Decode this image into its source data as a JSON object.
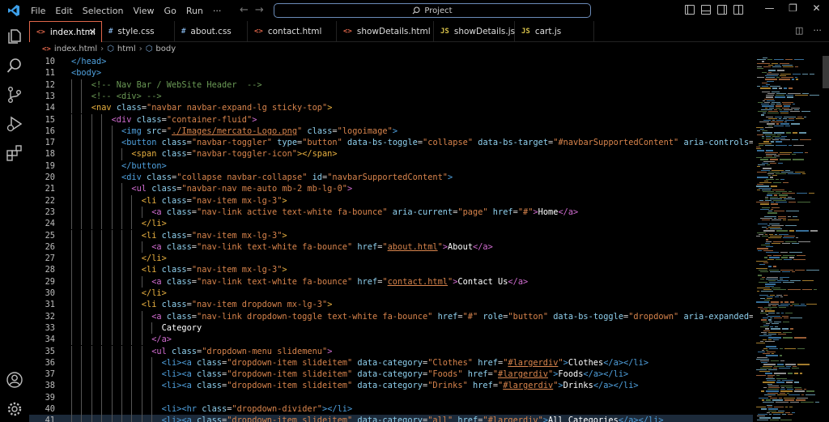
{
  "menu": [
    "File",
    "Edit",
    "Selection",
    "View",
    "Go",
    "Run",
    "···"
  ],
  "search": {
    "label": "Project"
  },
  "tabs": [
    {
      "label": "index.html",
      "icon": "<>",
      "icon_color": "#e0664a",
      "active": true
    },
    {
      "label": "style.css",
      "icon": "#",
      "icon_color": "#7aa7d6",
      "active": false
    },
    {
      "label": "about.css",
      "icon": "#",
      "icon_color": "#7aa7d6",
      "active": false
    },
    {
      "label": "contact.html",
      "icon": "<>",
      "icon_color": "#e0664a",
      "active": false
    },
    {
      "label": "showDetails.html",
      "icon": "<>",
      "icon_color": "#e0664a",
      "active": false
    },
    {
      "label": "showDetails.js",
      "icon": "JS",
      "icon_color": "#d8c24a",
      "active": false
    },
    {
      "label": "cart.js",
      "icon": "JS",
      "icon_color": "#d8c24a",
      "active": false
    }
  ],
  "breadcrumb": [
    "index.html",
    "html",
    "body"
  ],
  "code_lines": [
    {
      "n": "10",
      "indent": 0,
      "html": "<span class='t'>&lt;/head&gt;</span>"
    },
    {
      "n": "11",
      "indent": 0,
      "html": "<span class='t'>&lt;body&gt;</span>"
    },
    {
      "n": "12",
      "indent": 2,
      "html": "<span class='cm'>&lt;!-- Nav Bar / WebSite Header  --&gt;</span>"
    },
    {
      "n": "13",
      "indent": 2,
      "html": "<span class='cm'>&lt;!-- &lt;div&gt; --&gt;</span>"
    },
    {
      "n": "14",
      "indent": 2,
      "html": "<span class='tg'>&lt;nav</span> <span class='at'>class</span><span class='br'>=</span><span class='st'>\"navbar navbar-expand-lg sticky-top\"</span><span class='tg'>&gt;</span>"
    },
    {
      "n": "15",
      "indent": 4,
      "html": "<span class='t' style='color:#d06cd0'>&lt;div</span> <span class='at'>class</span><span class='br'>=</span><span class='st'>\"container-fluid\"</span><span class='t' style='color:#d06cd0'>&gt;</span>"
    },
    {
      "n": "16",
      "indent": 5,
      "html": "<span class='t'>&lt;img</span> <span class='at'>src</span><span class='br'>=</span><span class='st'>\"<u>./Images/mercato-Logo.png</u>\"</span> <span class='at'>class</span><span class='br'>=</span><span class='st'>\"logoimage\"</span><span class='t'>&gt;</span>"
    },
    {
      "n": "17",
      "indent": 5,
      "html": "<span class='t'>&lt;button</span> <span class='at'>class</span><span class='br'>=</span><span class='st'>\"navbar-toggler\"</span> <span class='at'>type</span><span class='br'>=</span><span class='st'>\"button\"</span> <span class='at'>data-bs-toggle</span><span class='br'>=</span><span class='st'>\"collapse\"</span> <span class='at'>data-bs-target</span><span class='br'>=</span><span class='st'>\"#navbarSupportedContent\"</span> <span class='at'>aria-controls</span><span class='br'>=</span><span class='st'>\"navbarSu</span>"
    },
    {
      "n": "18",
      "indent": 6,
      "html": "<span class='tg'>&lt;span</span> <span class='at'>class</span><span class='br'>=</span><span class='st'>\"navbar-toggler-icon\"</span><span class='tg'>&gt;&lt;/span&gt;</span>"
    },
    {
      "n": "19",
      "indent": 5,
      "html": "<span class='t'>&lt;/button&gt;</span>"
    },
    {
      "n": "20",
      "indent": 5,
      "html": "<span class='t'>&lt;div</span> <span class='at'>class</span><span class='br'>=</span><span class='st'>\"collapse navbar-collapse\"</span> <span class='at'>id</span><span class='br'>=</span><span class='st'>\"navbarSupportedContent\"</span><span class='t'>&gt;</span>"
    },
    {
      "n": "21",
      "indent": 6,
      "html": "<span class='tg' style='color:#d06cd0'>&lt;ul</span> <span class='at'>class</span><span class='br'>=</span><span class='st'>\"navbar-nav me-auto mb-2 mb-lg-0\"</span><span class='tg' style='color:#d06cd0'>&gt;</span>"
    },
    {
      "n": "22",
      "indent": 7,
      "html": "<span class='tg'>&lt;li</span> <span class='at'>class</span><span class='br'>=</span><span class='st'>\"nav-item mx-lg-3\"</span><span class='tg'>&gt;</span>"
    },
    {
      "n": "23",
      "indent": 8,
      "html": "<span class='tg' style='color:#d06cd0'>&lt;a</span> <span class='at'>class</span><span class='br'>=</span><span class='st'>\"nav-link active text-white fa-bounce\"</span> <span class='at'>aria-current</span><span class='br'>=</span><span class='st'>\"page\"</span> <span class='at'>href</span><span class='br'>=</span><span class='st'>\"#\"</span><span class='tg' style='color:#d06cd0'>&gt;</span><span class='tx'>Home</span><span class='tg' style='color:#d06cd0'>&lt;/a&gt;</span>"
    },
    {
      "n": "24",
      "indent": 7,
      "html": "<span class='tg'>&lt;/li&gt;</span>"
    },
    {
      "n": "25",
      "indent": 7,
      "html": "<span class='tg'>&lt;li</span> <span class='at'>class</span><span class='br'>=</span><span class='st'>\"nav-item mx-lg-3\"</span><span class='tg'>&gt;</span>"
    },
    {
      "n": "26",
      "indent": 8,
      "html": "<span class='tg' style='color:#d06cd0'>&lt;a</span> <span class='at'>class</span><span class='br'>=</span><span class='st'>\"nav-link text-white fa-bounce\"</span> <span class='at'>href</span><span class='br'>=</span><span class='st'>\"<u>about.html</u>\"</span><span class='tg' style='color:#d06cd0'>&gt;</span><span class='tx'>About</span><span class='tg' style='color:#d06cd0'>&lt;/a&gt;</span>"
    },
    {
      "n": "27",
      "indent": 7,
      "html": "<span class='tg'>&lt;/li&gt;</span>"
    },
    {
      "n": "28",
      "indent": 7,
      "html": "<span class='tg'>&lt;li</span> <span class='at'>class</span><span class='br'>=</span><span class='st'>\"nav-item mx-lg-3\"</span><span class='tg'>&gt;</span>"
    },
    {
      "n": "29",
      "indent": 8,
      "html": "<span class='tg' style='color:#d06cd0'>&lt;a</span> <span class='at'>class</span><span class='br'>=</span><span class='st'>\"nav-link text-white fa-bounce\"</span> <span class='at'>href</span><span class='br'>=</span><span class='st'>\"<u>contact.html</u>\"</span><span class='tg' style='color:#d06cd0'>&gt;</span><span class='tx'>Contact Us</span><span class='tg' style='color:#d06cd0'>&lt;/a&gt;</span>"
    },
    {
      "n": "30",
      "indent": 7,
      "html": "<span class='tg'>&lt;/li&gt;</span>"
    },
    {
      "n": "31",
      "indent": 7,
      "html": "<span class='tg'>&lt;li</span> <span class='at'>class</span><span class='br'>=</span><span class='st'>\"nav-item dropdown mx-lg-3\"</span><span class='tg'>&gt;</span>"
    },
    {
      "n": "32",
      "indent": 8,
      "html": "<span class='tg' style='color:#d06cd0'>&lt;a</span> <span class='at'>class</span><span class='br'>=</span><span class='st'>\"nav-link dropdown-toggle text-white fa-bounce\"</span> <span class='at'>href</span><span class='br'>=</span><span class='st'>\"#\"</span> <span class='at'>role</span><span class='br'>=</span><span class='st'>\"button\"</span> <span class='at'>data-bs-toggle</span><span class='br'>=</span><span class='st'>\"dropdown\"</span> <span class='at'>aria-expanded</span><span class='br'>=</span><span class='st'>\"false\"</span><span class='tg' style='color:#d06cd0'>&gt;</span>"
    },
    {
      "n": "33",
      "indent": 9,
      "html": "<span class='tx'>Category</span>"
    },
    {
      "n": "34",
      "indent": 8,
      "html": "<span class='tg' style='color:#d06cd0'>&lt;/a&gt;</span>"
    },
    {
      "n": "35",
      "indent": 8,
      "html": "<span class='tg' style='color:#d06cd0'>&lt;ul</span> <span class='at'>class</span><span class='br'>=</span><span class='st'>\"dropdown-menu slidemenu\"</span><span class='tg' style='color:#d06cd0'>&gt;</span>"
    },
    {
      "n": "36",
      "indent": 9,
      "html": "<span class='t'>&lt;li&gt;&lt;a</span> <span class='at'>class</span><span class='br'>=</span><span class='st'>\"dropdown-item slideitem\"</span> <span class='at'>data-category</span><span class='br'>=</span><span class='st'>\"Clothes\"</span> <span class='at'>href</span><span class='br'>=</span><span class='st'>\"<u>#largerdiv</u>\"</span><span class='t'>&gt;</span><span class='tx'>Clothes</span><span class='t'>&lt;/a&gt;&lt;/li&gt;</span>"
    },
    {
      "n": "37",
      "indent": 9,
      "html": "<span class='t'>&lt;li&gt;&lt;a</span> <span class='at'>class</span><span class='br'>=</span><span class='st'>\"dropdown-item slideitem\"</span> <span class='at'>data-category</span><span class='br'>=</span><span class='st'>\"Foods\"</span> <span class='at'>href</span><span class='br'>=</span><span class='st'>\"<u>#largerdiv</u>\"</span><span class='t'>&gt;</span><span class='tx'>Foods</span><span class='t'>&lt;/a&gt;&lt;/li&gt;</span>"
    },
    {
      "n": "38",
      "indent": 9,
      "html": "<span class='t'>&lt;li&gt;&lt;a</span> <span class='at'>class</span><span class='br'>=</span><span class='st'>\"dropdown-item slideitem\"</span> <span class='at'>data-category</span><span class='br'>=</span><span class='st'>\"Drinks\"</span> <span class='at'>href</span><span class='br'>=</span><span class='st'>\"<u>#largerdiv</u>\"</span><span class='t'>&gt;</span><span class='tx'>Drinks</span><span class='t'>&lt;/a&gt;&lt;/li&gt;</span>"
    },
    {
      "n": "39",
      "indent": 9,
      "html": ""
    },
    {
      "n": "40",
      "indent": 9,
      "html": "<span class='t'>&lt;li&gt;&lt;hr</span> <span class='at'>class</span><span class='br'>=</span><span class='st'>\"dropdown-divider\"</span><span class='t'>&gt;&lt;/li&gt;</span>"
    },
    {
      "n": "41",
      "indent": 9,
      "html": "<span class='t'>&lt;li&gt;&lt;a</span> <span class='at'>class</span><span class='br'>=</span><span class='st'>\"dropdown-item slideitem\"</span> <span class='at'>data-category</span><span class='br'>=</span><span class='st'>\"all\"</span> <span class='at'>href</span><span class='br'>=</span><span class='st'>\"<u>#largerdiv</u>\"</span><span class='t'>&gt;</span><span class='tx'>All Categories</span><span class='t'>&lt;/a&gt;&lt;/li&gt;</span>"
    }
  ],
  "colors": {
    "accent": "#e0664a",
    "search_border": "#6b8bb8"
  }
}
